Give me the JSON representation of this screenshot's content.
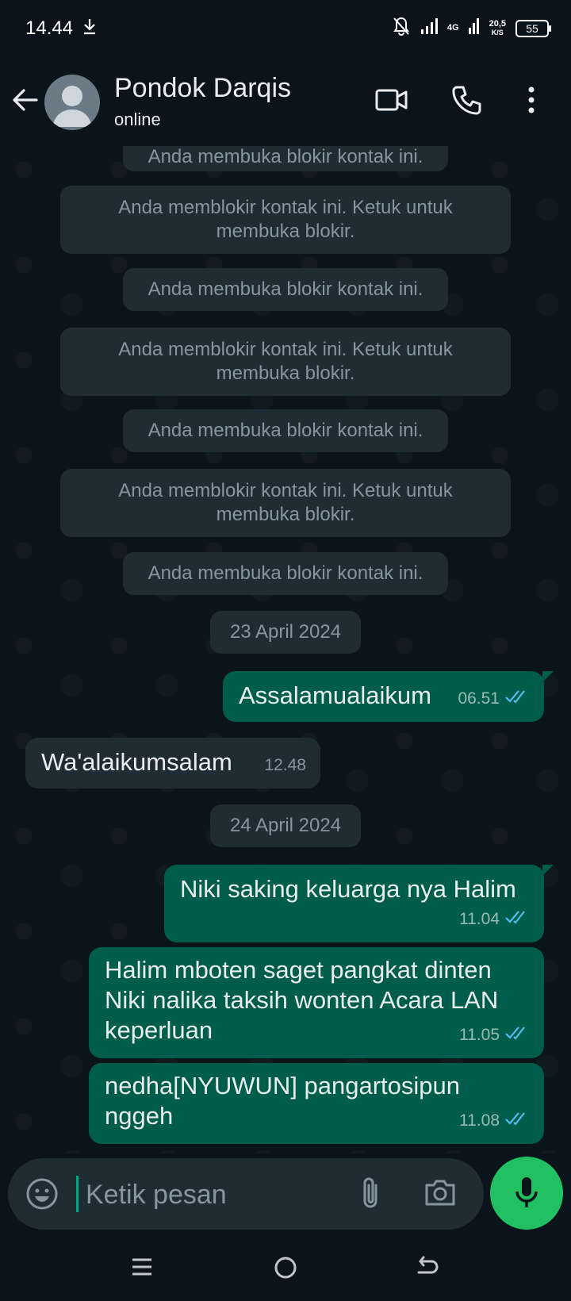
{
  "status_bar": {
    "time": "14.44",
    "network_type": "4G",
    "net_speed_value": "20,5",
    "net_speed_unit": "K/S",
    "battery": "55"
  },
  "header": {
    "contact_name": "Pondok Darqis",
    "contact_status": "online"
  },
  "messages": {
    "sys0": "Anda membuka blokir kontak ini.",
    "sys1": "Anda memblokir kontak ini. Ketuk untuk membuka blokir.",
    "sys2": "Anda membuka blokir kontak ini.",
    "sys3": "Anda memblokir kontak ini. Ketuk untuk membuka blokir.",
    "sys4": "Anda membuka blokir kontak ini.",
    "sys5": "Anda memblokir kontak ini. Ketuk untuk membuka blokir.",
    "sys6": "Anda membuka blokir kontak ini.",
    "date1": "23 April 2024",
    "m1_text": "Assalamualaikum",
    "m1_time": "06.51",
    "m2_text": "Wa'alaikumsalam",
    "m2_time": "12.48",
    "date2": "24 April 2024",
    "m3_text": "Niki saking keluarga nya Halim",
    "m3_time": "11.04",
    "m4_text": "Halim mboten saget pangkat dinten Niki nalika taksih wonten Acara LAN keperluan",
    "m4_time": "11.05",
    "m5_text": "nedha[NYUWUN] pangartosipun nggeh",
    "m5_time": "11.08"
  },
  "composer": {
    "placeholder": "Ketik pesan",
    "value": ""
  },
  "colors": {
    "background": "#0b141a",
    "outgoing_bubble": "#005c4b",
    "incoming_bubble": "#1f2c34",
    "read_ticks": "#53bdeb",
    "mic_button": "#21c063"
  }
}
